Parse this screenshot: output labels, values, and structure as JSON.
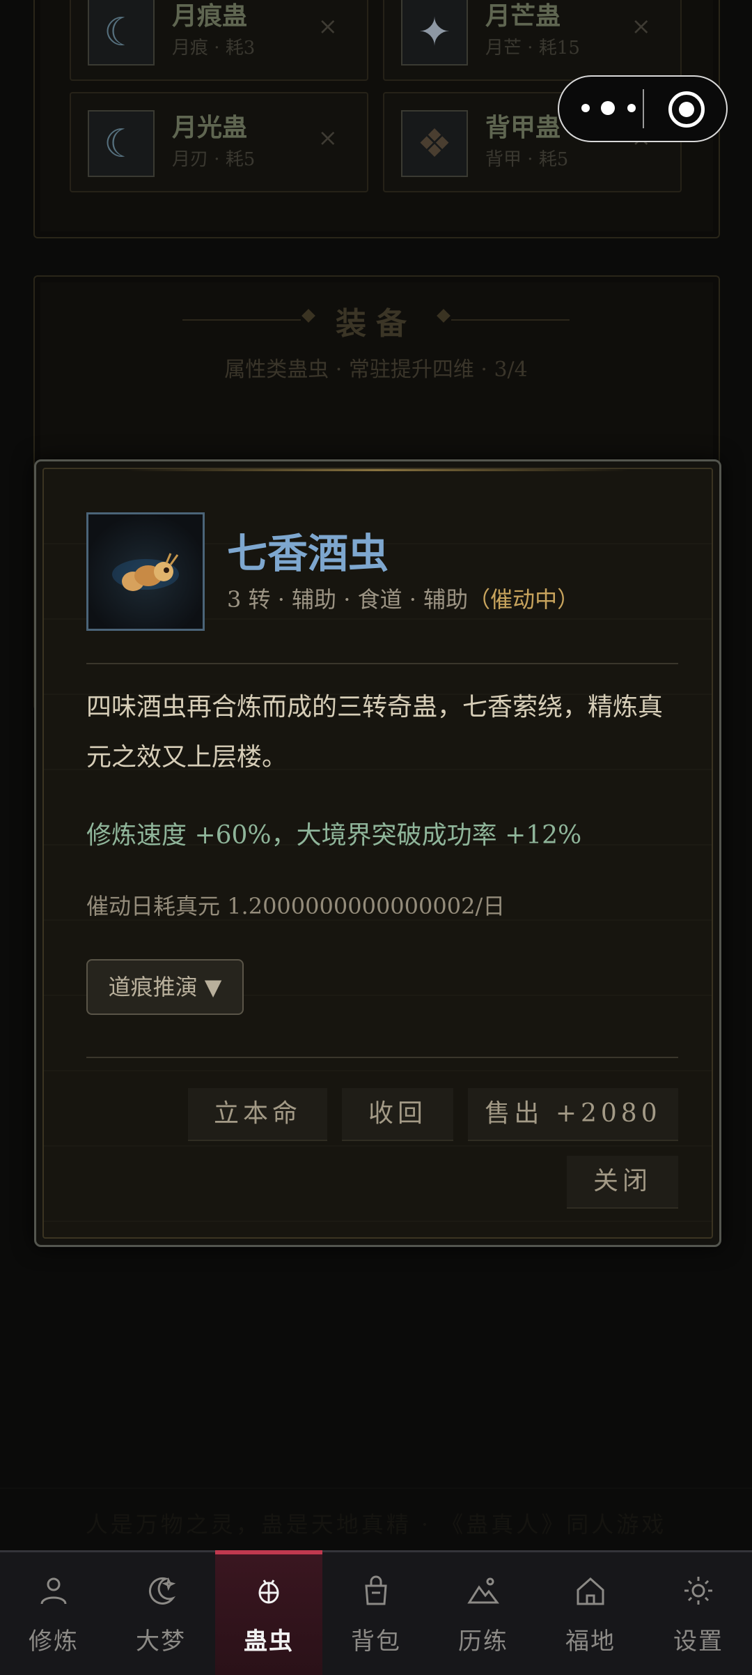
{
  "background": {
    "gu_cards": [
      {
        "name": "月痕蛊",
        "sub": "月痕 · 耗3",
        "icon": "moon-icon"
      },
      {
        "name": "月芒蛊",
        "sub": "月芒 · 耗15",
        "icon": "star-icon"
      },
      {
        "name": "月光蛊",
        "sub": "月刃 · 耗5",
        "icon": "moon-icon"
      },
      {
        "name": "背甲蛊",
        "sub": "背甲 · 耗5",
        "icon": "shell-icon"
      }
    ],
    "remove_symbol": "×",
    "equip_title": "装备",
    "equip_subtitle": "属性类蛊虫 · 常驻提升四维 · 3/4",
    "slogan": "人是万物之灵，蛊是天地真精 · 《蛊真人》同人游戏"
  },
  "modal": {
    "name": "七香酒虫",
    "meta": "3 转 · 辅助 · 食道 · 辅助",
    "meta_status": "（催动中）",
    "description": "四味酒虫再合炼而成的三转奇蛊，七香萦绕，精炼真元之效又上层楼。",
    "effect": "修炼速度 +60%，大境界突破成功率 +12%",
    "cost": "催动日耗真元 1.2000000000000002/日",
    "dropdown_label": "道痕推演 ▼",
    "buttons": {
      "bind": "立本命",
      "recall": "收回",
      "sell": "售出 +2080",
      "close": "关闭"
    }
  },
  "tabbar": {
    "tabs": [
      {
        "label": "修炼",
        "icon": "person-icon",
        "active": false
      },
      {
        "label": "大梦",
        "icon": "moon-icon",
        "active": false
      },
      {
        "label": "蛊虫",
        "icon": "bug-icon",
        "active": true
      },
      {
        "label": "背包",
        "icon": "bag-icon",
        "active": false
      },
      {
        "label": "历练",
        "icon": "mountain-icon",
        "active": false
      },
      {
        "label": "福地",
        "icon": "home-icon",
        "active": false
      },
      {
        "label": "设置",
        "icon": "sun-gear-icon",
        "active": false
      }
    ]
  },
  "colors": {
    "accent_active_tab": "#c0394f",
    "item_name": "#7ea7cf",
    "status_active": "#c8a45d",
    "effect_text": "#8fb59a"
  }
}
